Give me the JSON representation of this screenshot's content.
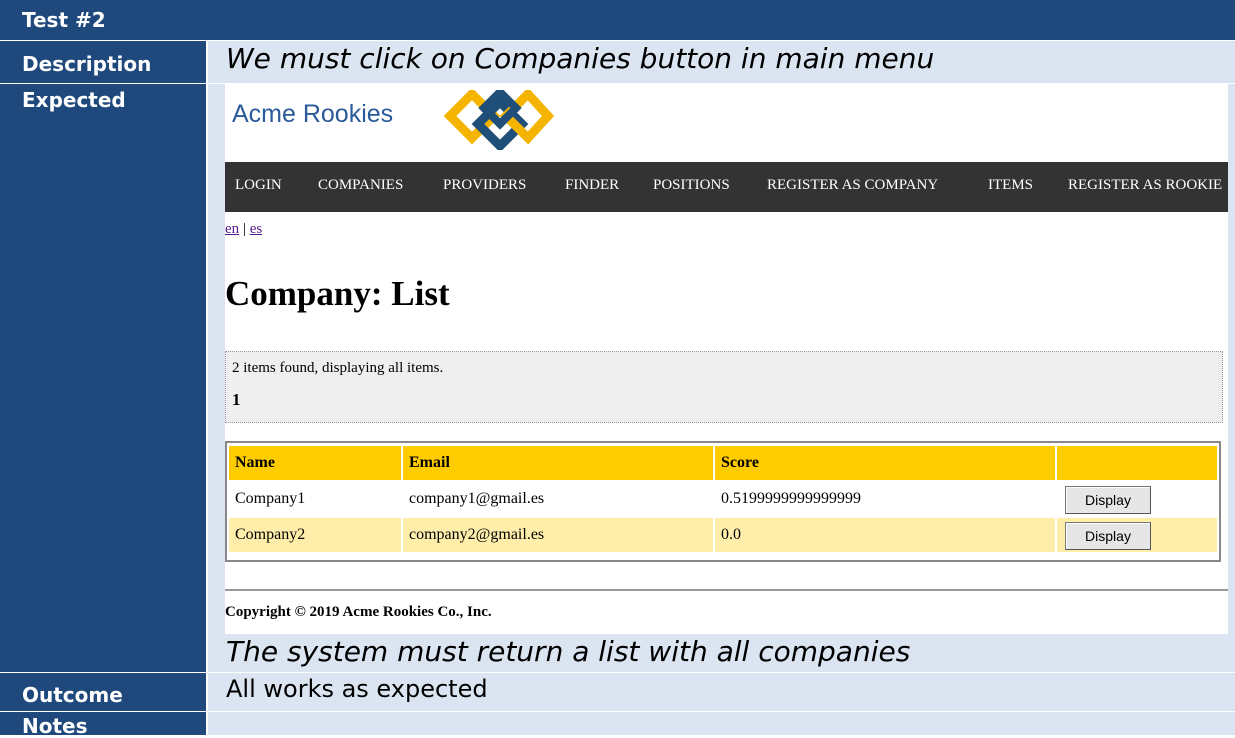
{
  "test": {
    "title": "Test #2",
    "description_label": "Description",
    "description": "We must click on Companies button in main menu",
    "expected_label": "Expected",
    "expected_text": "The system must return a list with all companies",
    "outcome_label": "Outcome",
    "outcome": "All works as expected",
    "notes_label": "Notes",
    "notes": ""
  },
  "screenshot": {
    "logo_text": "Acme Rookies",
    "logo_colors": [
      "#1f4e79",
      "#f5b400"
    ],
    "nav": [
      "LOGIN",
      "COMPANIES",
      "PROVIDERS",
      "FINDER",
      "POSITIONS",
      "REGISTER AS COMPANY",
      "ITEMS",
      "REGISTER AS ROOKIE"
    ],
    "lang": [
      "en",
      "es"
    ],
    "lang_sep": "|",
    "page_title": "Company: List",
    "pager_text": "2 items found, displaying all items.",
    "page_number": "1",
    "table": {
      "headers": [
        "Name",
        "Email",
        "Score",
        ""
      ],
      "rows": [
        {
          "name": "Company1",
          "email": "company1@gmail.es",
          "score": "0.5199999999999999",
          "action": "Display"
        },
        {
          "name": "Company2",
          "email": "company2@gmail.es",
          "score": "0.0",
          "action": "Display"
        }
      ]
    },
    "copyright": "Copyright © 2019 Acme Rookies Co., Inc."
  }
}
